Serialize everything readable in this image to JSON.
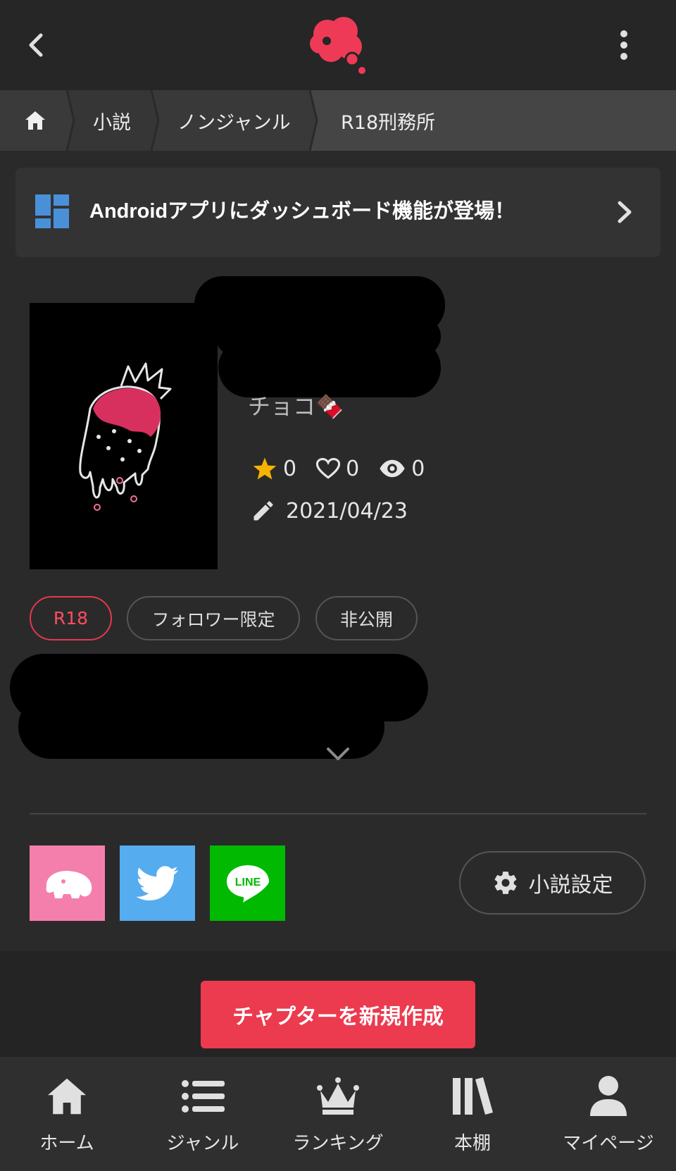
{
  "header": {
    "back_icon": "chevron-left-icon",
    "logo": "speech-bubble-logo",
    "menu_icon": "more-vertical-icon",
    "accent_color": "#ec3a4f"
  },
  "breadcrumb": {
    "home_icon": "home-icon",
    "items": [
      "小説",
      "ノンジャンル",
      "R18刑務所"
    ]
  },
  "promo": {
    "icon": "dashboard-icon",
    "text": "Androidアプリにダッシュボード機能が登場！",
    "chevron": "chevron-right-icon",
    "icon_color": "#4a90d9"
  },
  "novel": {
    "author": "チョコ🍫",
    "stats": {
      "stars": "0",
      "likes": "0",
      "views": "0"
    },
    "updated": "2021/04/23",
    "tags": [
      "R18",
      "フォロワー限定",
      "非公開"
    ]
  },
  "share": {
    "buttons": [
      {
        "name": "misskey",
        "color": "#f57fac"
      },
      {
        "name": "twitter",
        "color": "#55acee"
      },
      {
        "name": "line",
        "color": "#00b900",
        "label": "LINE"
      }
    ],
    "settings_label": "小説設定"
  },
  "actions": {
    "create_chapter": "チャプターを新規作成"
  },
  "bottom_nav": [
    {
      "label": "ホーム",
      "icon": "home-icon"
    },
    {
      "label": "ジャンル",
      "icon": "list-icon"
    },
    {
      "label": "ランキング",
      "icon": "crown-icon"
    },
    {
      "label": "本棚",
      "icon": "bookshelf-icon"
    },
    {
      "label": "マイページ",
      "icon": "user-icon"
    }
  ]
}
